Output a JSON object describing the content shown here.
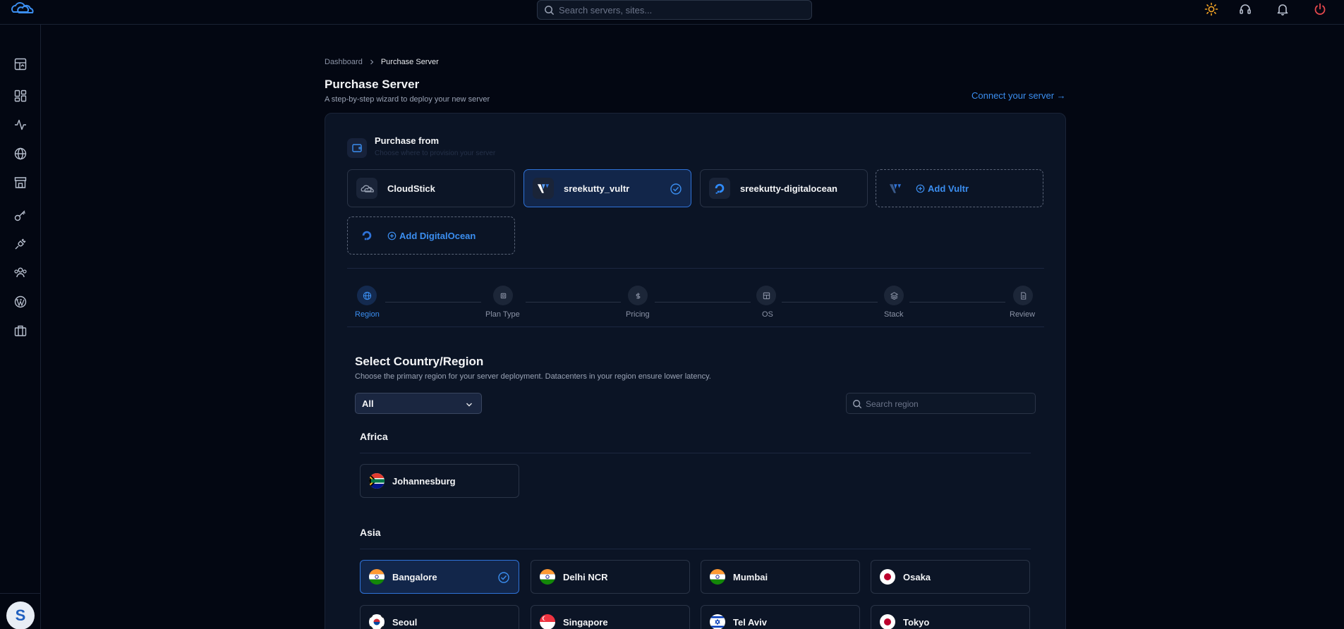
{
  "topbar": {
    "search_placeholder": "Search servers, sites...",
    "icons": [
      "cloudstick-logo",
      "sun-icon",
      "headset-icon",
      "bell-icon",
      "power-icon"
    ]
  },
  "sidebar": {
    "items": [
      "dashboard-icon",
      "grid-icon",
      "activity-icon",
      "globe-icon",
      "store-icon",
      "key-icon",
      "plug-icon",
      "users-icon",
      "wordpress-icon",
      "briefcase-icon"
    ],
    "avatar": "S"
  },
  "breadcrumb": {
    "items": [
      "Dashboard",
      "Purchase Server"
    ]
  },
  "page": {
    "title": "Purchase Server",
    "subtitle": "A step-by-step wizard to deploy your new server",
    "connect_link": "Connect your server →"
  },
  "purchase_from": {
    "title": "Purchase from",
    "subtitle": "Choose where to provision your server",
    "providers": [
      {
        "label": "CloudStick",
        "type": "cloudstick",
        "selected": false
      },
      {
        "label": "sreekutty_vultr",
        "type": "vultr",
        "selected": true
      },
      {
        "label": "sreekutty-digitalocean",
        "type": "digitalocean",
        "selected": false
      }
    ],
    "add_vultr": "Add Vultr",
    "add_digitalocean": "Add DigitalOcean"
  },
  "steps": [
    {
      "label": "Region",
      "icon": "globe-icon",
      "active": true
    },
    {
      "label": "Plan Type",
      "icon": "chip-icon",
      "active": false
    },
    {
      "label": "Pricing",
      "icon": "dollar-icon",
      "active": false
    },
    {
      "label": "OS",
      "icon": "layout-icon",
      "active": false
    },
    {
      "label": "Stack",
      "icon": "layers-icon",
      "active": false
    },
    {
      "label": "Review",
      "icon": "document-icon",
      "active": false
    }
  ],
  "region_section": {
    "title": "Select Country/Region",
    "subtitle": "Choose the primary region for your server deployment. Datacenters in your region ensure lower latency.",
    "filter_value": "All",
    "search_placeholder": "Search region",
    "groups": [
      {
        "name": "Africa",
        "regions": [
          {
            "name": "Johannesburg",
            "flag": "za"
          }
        ]
      },
      {
        "name": "Asia",
        "regions": [
          {
            "name": "Bangalore",
            "flag": "in",
            "selected": true
          },
          {
            "name": "Delhi NCR",
            "flag": "in"
          },
          {
            "name": "Mumbai",
            "flag": "in"
          },
          {
            "name": "Osaka",
            "flag": "jp"
          },
          {
            "name": "Seoul",
            "flag": "kr"
          },
          {
            "name": "Singapore",
            "flag": "sg"
          },
          {
            "name": "Tel Aviv",
            "flag": "il"
          },
          {
            "name": "Tokyo",
            "flag": "jp"
          }
        ]
      }
    ]
  },
  "colors": {
    "accent": "#3b8ef0",
    "background": "#030712",
    "panel": "#0b1425"
  }
}
